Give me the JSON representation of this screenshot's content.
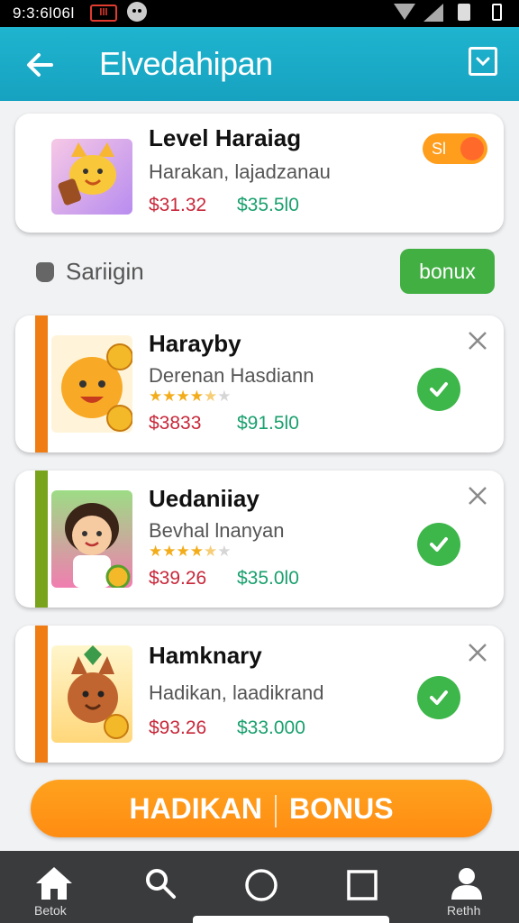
{
  "status_bar": {
    "time": "9:3:6l06l",
    "battery_low_label": "lll"
  },
  "app_bar": {
    "back_icon": "arrow-left-icon",
    "title": "Elvedahipan",
    "menu_icon": "chevron-down-icon"
  },
  "top_card": {
    "title": "Level Haraiag",
    "subtitle": "Harakan, lajadzanau",
    "old_price": "$31.32",
    "new_price": "$35.5l0",
    "badge": "Sl"
  },
  "section": {
    "title": "Sariigin",
    "chip": "bonux"
  },
  "offers": [
    {
      "title": "Harayby",
      "subtitle": "Derenan Hasdiann",
      "rating": 3.5,
      "old_price": "$3833",
      "new_price": "$91.5l0",
      "accent": "#f07d14"
    },
    {
      "title": "Uedaniiay",
      "subtitle": "Bevhal lnanyan",
      "rating": 3.5,
      "old_price": "$39.26",
      "new_price": "$35.0l0",
      "accent": "#79a31b"
    },
    {
      "title": "Hamknary",
      "subtitle": "Hadikan, laadikrand",
      "old_price": "$93.26",
      "new_price": "$33.000",
      "accent": "#f07d14"
    }
  ],
  "cta": {
    "left": "HADIKAN",
    "right": "BONUS"
  },
  "bottom_nav": {
    "items": [
      {
        "icon": "home-icon",
        "label": "Betok"
      },
      {
        "icon": "search-icon",
        "label": ""
      },
      {
        "icon": "circle-icon",
        "label": ""
      },
      {
        "icon": "square-icon",
        "label": ""
      },
      {
        "icon": "person-icon",
        "label": "Rethh"
      }
    ]
  },
  "colors": {
    "app_bar": "#1fb4cf",
    "check": "#3db64a",
    "cta": "#ff9a1b",
    "old_price": "#c8283a",
    "new_price": "#1aa06e"
  }
}
